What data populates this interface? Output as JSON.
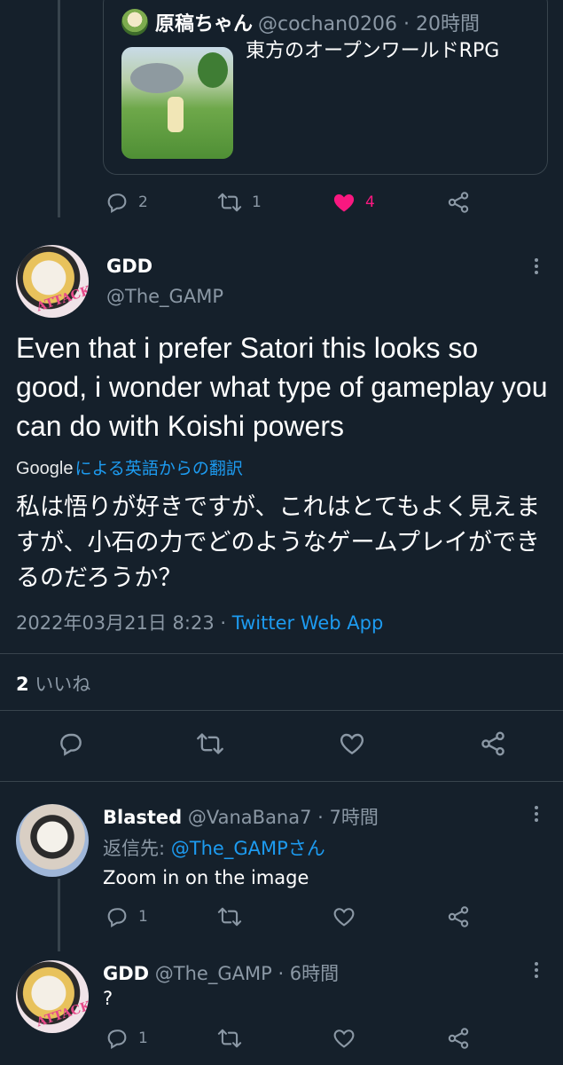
{
  "quoted": {
    "name": "原稿ちゃん",
    "handle_time": "@cochan0206 · 20時間",
    "text": "東方のオープンワールドRPG",
    "actions": {
      "reply": "2",
      "retweet": "1",
      "like": "4"
    }
  },
  "main_tweet": {
    "name": "GDD",
    "handle": "@The_GAMP",
    "avatar_text": "ATTACK!",
    "body": "Even that i prefer Satori this looks so good, i wonder what type of gameplay you can do with Koishi powers",
    "translate_brand": "Google",
    "translate_label": "による英語からの翻訳",
    "translation": "私は悟りが好きですが、これはとてもよく見えますが、小石の力でどのようなゲームプレイができるのだろうか？",
    "date": "2022年03月21日 8:23 · ",
    "source": "Twitter Web App",
    "like_count": "2",
    "like_label": " いいね"
  },
  "replies": [
    {
      "name": "Blasted",
      "handle_time": " @VanaBana7 · 7時間",
      "reply_to_prefix": "返信先: ",
      "reply_to_handle": "@The_GAMPさん",
      "text": "Zoom in on the image",
      "actions": {
        "reply": "1"
      }
    },
    {
      "name": "GDD",
      "handle_time": " @The_GAMP · 6時間",
      "avatar_text": "ATTACK!",
      "text": "?",
      "actions": {
        "reply": "1"
      }
    }
  ],
  "colors": {
    "background": "#15202b",
    "muted": "#8b98a5",
    "link": "#1d9bf0",
    "like": "#f91880",
    "border": "#38444d"
  },
  "icons": [
    "reply-icon",
    "retweet-icon",
    "like-icon",
    "share-icon",
    "more-icon"
  ]
}
